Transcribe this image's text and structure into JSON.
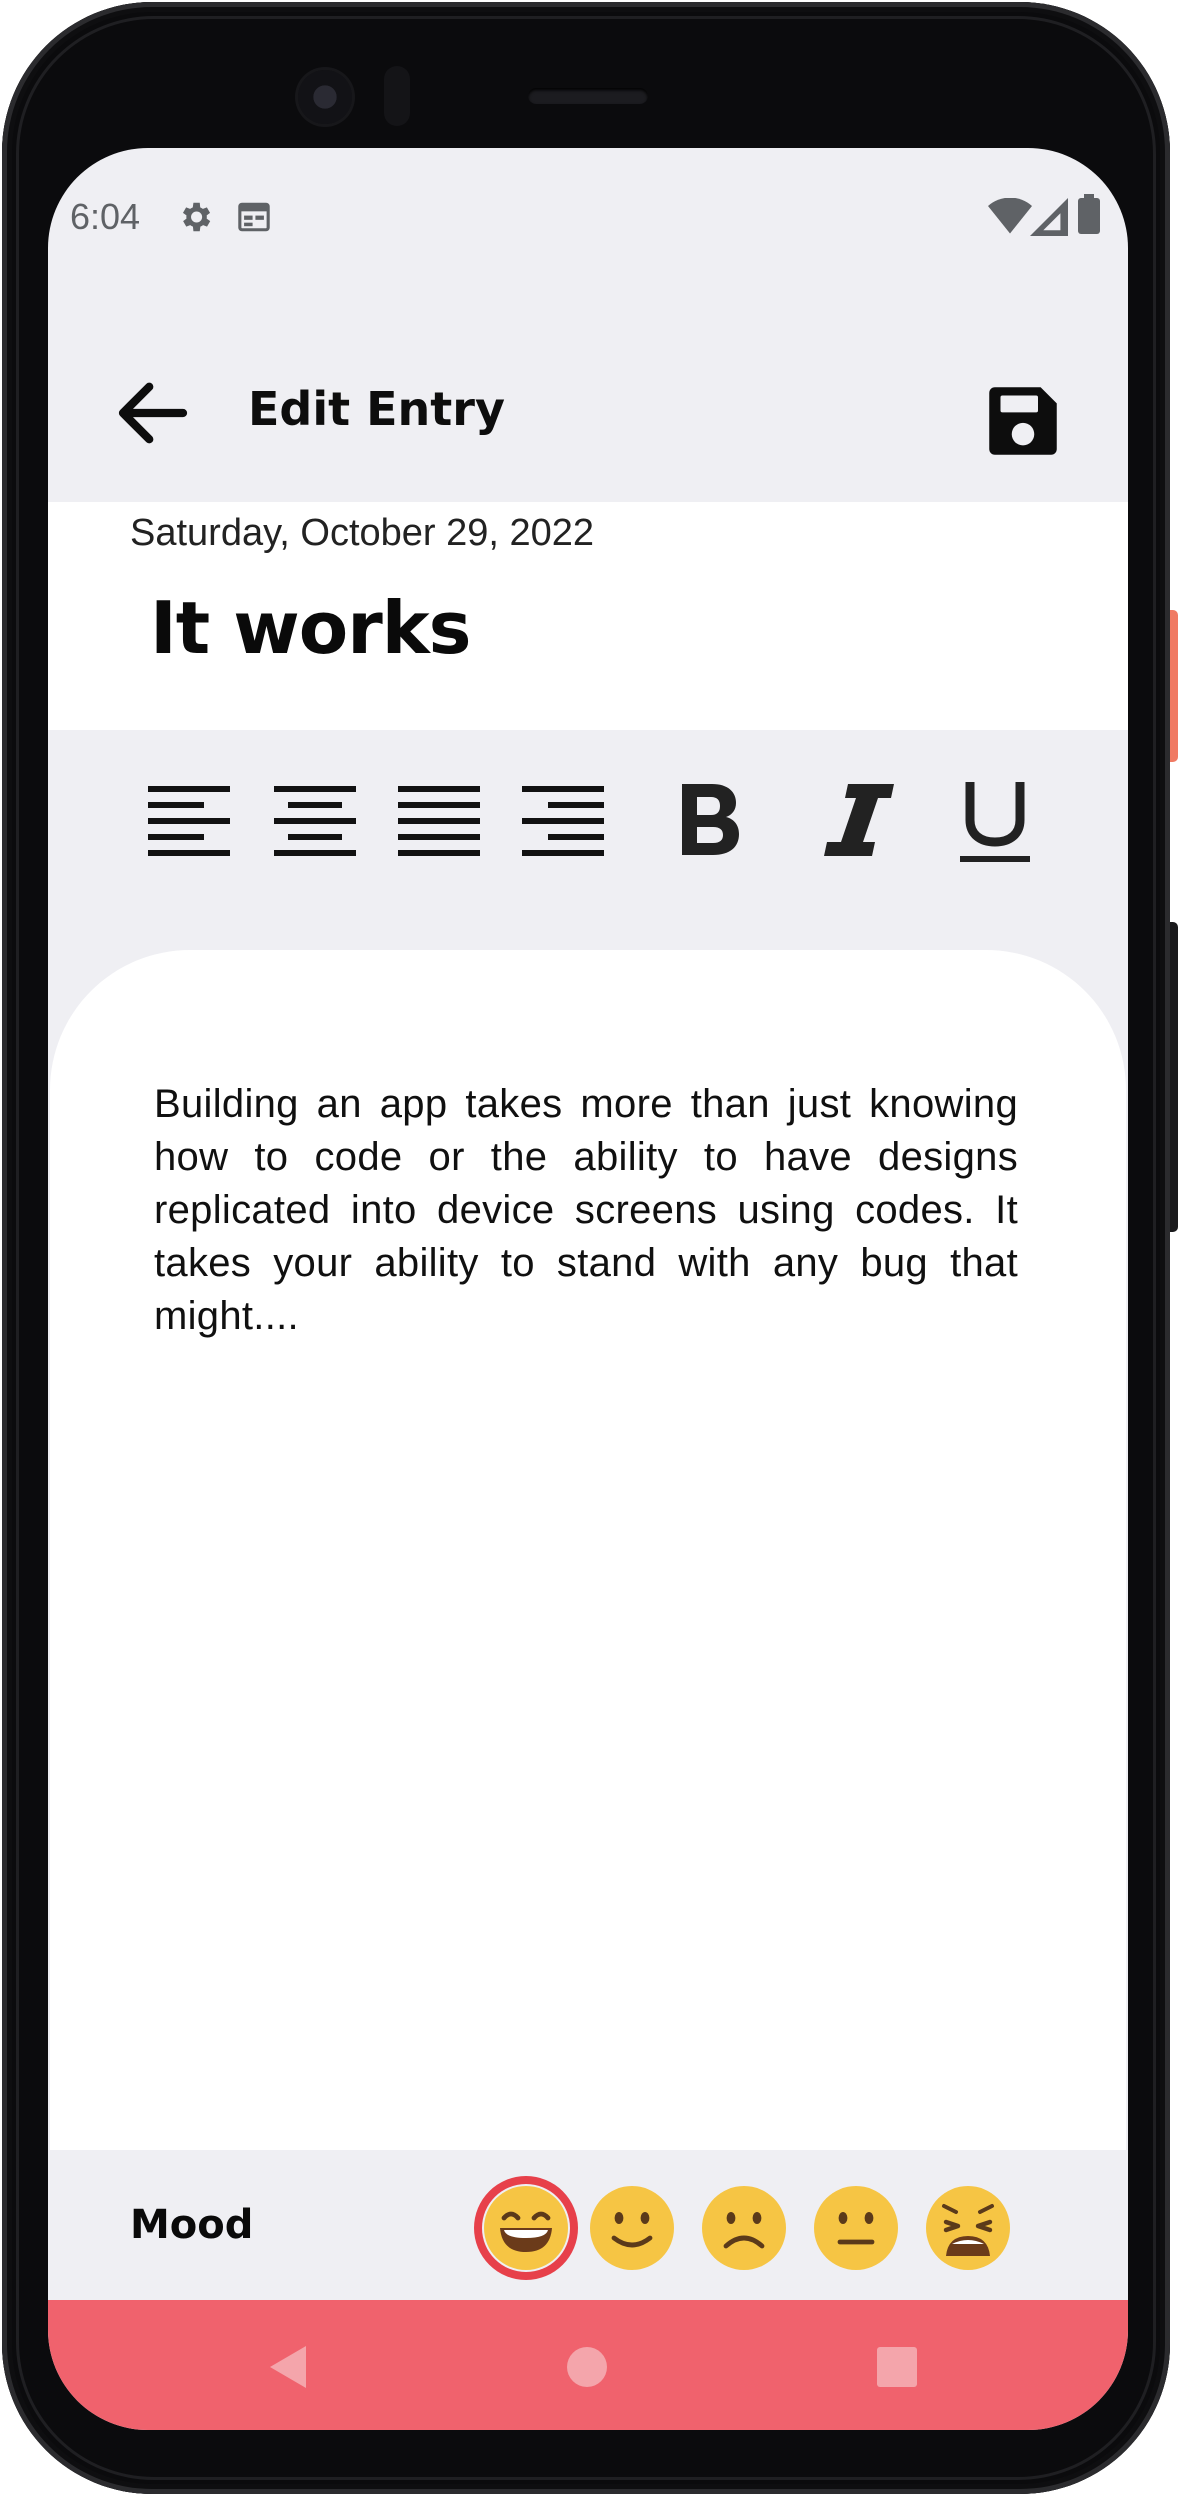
{
  "status_bar": {
    "time": "6:04",
    "left_icons": [
      "gear-icon",
      "calendar-icon"
    ],
    "right_icons": [
      "wifi-icon",
      "signal-icon",
      "battery-icon"
    ]
  },
  "app_bar": {
    "title": "Edit Entry",
    "back_icon": "arrow-left-icon",
    "save_icon": "floppy-disk-icon"
  },
  "entry": {
    "date": "Saturday, October 29, 2022",
    "title": "It works",
    "body": "Building an app takes more than just knowing how to code or the ability to have designs replicated into device screens using codes. It takes your ability to stand with any bug that might...."
  },
  "toolbar": {
    "buttons": [
      "align-left",
      "align-center",
      "align-justify",
      "align-right",
      "bold",
      "italic",
      "underline"
    ]
  },
  "mood": {
    "label": "Mood",
    "options": [
      "grinning",
      "slightly-smiling",
      "frowning",
      "neutral",
      "weary"
    ],
    "selected": "grinning"
  },
  "nav": {
    "buttons": [
      "back",
      "home",
      "recents"
    ]
  },
  "colors": {
    "background": "#efeff3",
    "card": "#ffffff",
    "accent": "#f0626d",
    "selected_ring": "#e7404a",
    "emoji_yellow": "#f6c544",
    "text": "#0a0a0a"
  }
}
